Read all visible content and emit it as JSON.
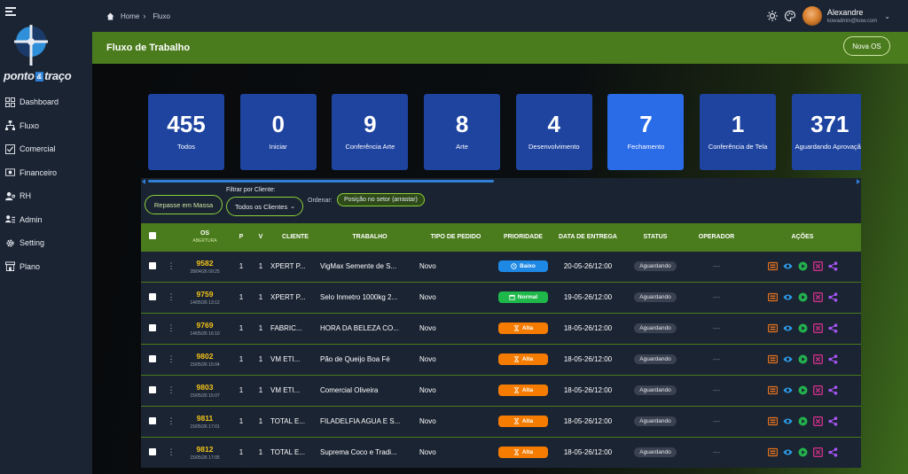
{
  "sidebar": {
    "logo_text": "ponto",
    "logo_amp": "&",
    "logo_text2": "traço",
    "items": [
      {
        "label": "Dashboard",
        "icon": "grid-icon"
      },
      {
        "label": "Fluxo",
        "icon": "org-chart-icon"
      },
      {
        "label": "Comercial",
        "icon": "checkbox-icon"
      },
      {
        "label": "Financeiro",
        "icon": "money-icon"
      },
      {
        "label": "RH",
        "icon": "person-key-icon"
      },
      {
        "label": "Admin",
        "icon": "users-list-icon"
      },
      {
        "label": "Setting",
        "icon": "gear-icon"
      },
      {
        "label": "Plano",
        "icon": "store-icon"
      }
    ]
  },
  "topbar": {
    "breadcrumb": [
      "Home",
      "Fluxo"
    ],
    "user": {
      "name": "Alexandre",
      "email": "kowadmin@kow.com"
    }
  },
  "header": {
    "title": "Fluxo de Trabalho",
    "new_button": "Nova OS"
  },
  "cards": [
    {
      "count": "455",
      "label": "Todos",
      "active": false
    },
    {
      "count": "0",
      "label": "Iniciar",
      "active": false
    },
    {
      "count": "9",
      "label": "Conferência Arte",
      "active": false
    },
    {
      "count": "8",
      "label": "Arte",
      "active": false
    },
    {
      "count": "4",
      "label": "Desenvolvimento",
      "active": false
    },
    {
      "count": "7",
      "label": "Fechamento",
      "active": true
    },
    {
      "count": "1",
      "label": "Conferência de Tela",
      "active": false
    },
    {
      "count": "371",
      "label": "Aguardando Aprovação",
      "active": false
    }
  ],
  "filters": {
    "repasse_button": "Repasse em Massa",
    "client_label": "Filtrar por Cliente:",
    "client_value": "Todos os Clientes",
    "order_label": "Ordenar:",
    "order_value": "Posição no setor (arrastar)"
  },
  "table": {
    "headers": {
      "os": "OS",
      "os_sub": "ABERTURA",
      "p": "P",
      "v": "V",
      "cliente": "CLIENTE",
      "trabalho": "TRABALHO",
      "tipo": "TIPO DE PEDIDO",
      "prioridade": "PRIORIDADE",
      "entrega": "DATA DE ENTREGA",
      "status": "STATUS",
      "operador": "OPERADOR",
      "acoes": "AÇÕES"
    },
    "rows": [
      {
        "os": "9582",
        "abertura": "28/04/26 09:25",
        "p": "1",
        "v": "1",
        "cliente": "XPERT P...",
        "trabalho": "VigMax Semente de S...",
        "tipo": "Novo",
        "prioridade": "Baixo",
        "pri_color": "#1e88e5",
        "pri_icon": "clock-icon",
        "entrega": "20-05-26/12:00",
        "status": "Aguardando",
        "operador": "—"
      },
      {
        "os": "9759",
        "abertura": "14/05/26 13:12",
        "p": "1",
        "v": "1",
        "cliente": "XPERT P...",
        "trabalho": "Selo Inmetro 1000kg 2...",
        "tipo": "Novo",
        "prioridade": "Normal",
        "pri_color": "#1fb84a",
        "pri_icon": "calendar-icon",
        "entrega": "19-05-26/12:00",
        "status": "Aguardando",
        "operador": "—"
      },
      {
        "os": "9769",
        "abertura": "14/05/26 16:10",
        "p": "1",
        "v": "1",
        "cliente": "FABRIC...",
        "trabalho": "HORA DA BELEZA CO...",
        "tipo": "Novo",
        "prioridade": "Alta",
        "pri_color": "#f57c00",
        "pri_icon": "hourglass-icon",
        "entrega": "18-05-26/12:00",
        "status": "Aguardando",
        "operador": "—"
      },
      {
        "os": "9802",
        "abertura": "15/05/26 15:04",
        "p": "1",
        "v": "1",
        "cliente": "VM ETI...",
        "trabalho": "Pão de Queijo Boa Fé",
        "tipo": "Novo",
        "prioridade": "Alta",
        "pri_color": "#f57c00",
        "pri_icon": "hourglass-icon",
        "entrega": "18-05-26/12:00",
        "status": "Aguardando",
        "operador": "—"
      },
      {
        "os": "9803",
        "abertura": "15/05/26 15:07",
        "p": "1",
        "v": "1",
        "cliente": "VM ETI...",
        "trabalho": "Comercial Oliveira",
        "tipo": "Novo",
        "prioridade": "Alta",
        "pri_color": "#f57c00",
        "pri_icon": "hourglass-icon",
        "entrega": "18-05-26/12:00",
        "status": "Aguardando",
        "operador": "—"
      },
      {
        "os": "9811",
        "abertura": "15/05/26 17:01",
        "p": "1",
        "v": "1",
        "cliente": "TOTAL E...",
        "trabalho": "FILADELFIA AGUA E S...",
        "tipo": "Novo",
        "prioridade": "Alta",
        "pri_color": "#f57c00",
        "pri_icon": "hourglass-icon",
        "entrega": "18-05-26/12:00",
        "status": "Aguardando",
        "operador": "—"
      },
      {
        "os": "9812",
        "abertura": "15/05/26 17:05",
        "p": "1",
        "v": "1",
        "cliente": "TOTAL E...",
        "trabalho": "Suprema Coco e Tradi...",
        "tipo": "Novo",
        "prioridade": "Alta",
        "pri_color": "#f57c00",
        "pri_icon": "hourglass-icon",
        "entrega": "18-05-26/12:00",
        "status": "Aguardando",
        "operador": "—"
      }
    ]
  },
  "colors": {
    "sidebar_bg": "#1b2433",
    "header_green": "#4a7b1c",
    "card_blue": "#1e44a0",
    "card_active": "#2a6be8",
    "os_yellow": "#f5c518",
    "action_orange": "#e8731e",
    "action_blue": "#2e9be6",
    "action_green": "#22b14c",
    "action_pink": "#d0308a",
    "action_purple": "#a855f7"
  },
  "icons": {
    "actions": [
      "card-icon",
      "eye-icon",
      "play-icon",
      "close-box-icon",
      "share-icon"
    ],
    "topbar": [
      "sun-icon",
      "palette-icon"
    ]
  }
}
